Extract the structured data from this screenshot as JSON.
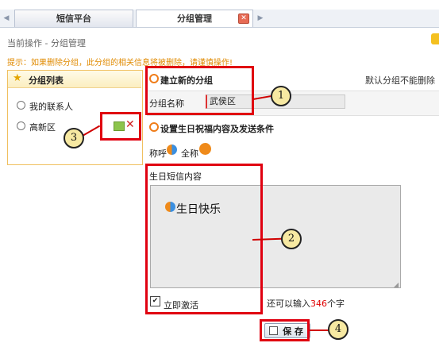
{
  "tabs": [
    {
      "label": "短信平台",
      "active": false
    },
    {
      "label": "分组管理",
      "active": true
    }
  ],
  "breadcrumb": "当前操作 - 分组管理",
  "warning": "提示：如果删除分组，此分组的相关信息将被删除，请谨慎操作!",
  "left_panel": {
    "title": "分组列表",
    "groups": [
      {
        "label": "我的联系人"
      },
      {
        "label": "高新区"
      }
    ]
  },
  "new_group": {
    "section_title": "建立新的分组",
    "note": "默认分组不能删除",
    "name_label": "分组名称",
    "name_value": "武侯区"
  },
  "birthday": {
    "section_title": "设置生日祝福内容及发送条件",
    "salutation_label": "称呼",
    "fullname_label": "全称",
    "content_label": "生日短信内容",
    "content_text": "生日快乐",
    "activate_label": "立即激活",
    "activate_checked": true,
    "remaining_prefix": "还可以输入",
    "remaining_count": "346",
    "remaining_suffix": "个字"
  },
  "save_label": "保 存",
  "callouts": [
    "1",
    "2",
    "3",
    "4"
  ],
  "colors": {
    "accent_orange": "#ef7d1a",
    "annotation_red": "#e00010",
    "callout_fill": "#f7e9a2",
    "count_red": "#e00000"
  }
}
